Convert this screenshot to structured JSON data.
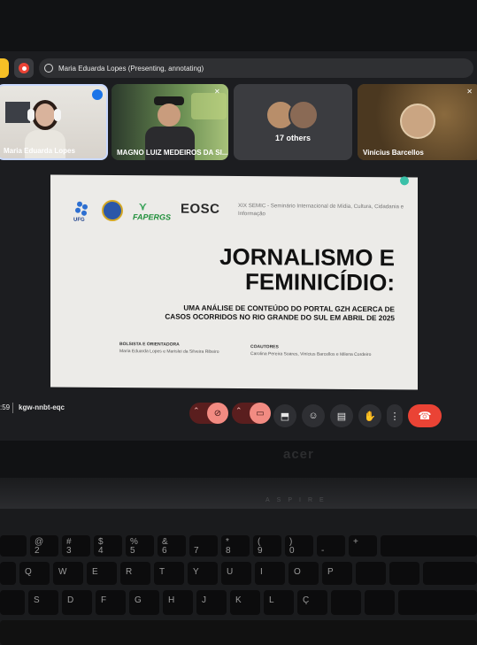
{
  "presenter_label": "Maria Eduarda Lopes (Presenting, annotating)",
  "participants": [
    {
      "name": "Maria Eduarda Lopes"
    },
    {
      "name": "MAGNO LUIZ MEDEIROS DA SI..."
    },
    {
      "name": "17 others"
    },
    {
      "name": "Vinícius Barcellos"
    }
  ],
  "slide": {
    "logos": [
      "UFG",
      "FAPERGS",
      "EOSC"
    ],
    "event": "XIX SEMIC - Seminário Internacional de Mídia, Cultura, Cidadania e Informação",
    "title_line1": "JORNALISMO E",
    "title_line2": "FEMINICÍDIO:",
    "subtitle_line1": "UMA ANÁLISE DE CONTEÚDO DO PORTAL GZH ACERCA DE",
    "subtitle_line2": "CASOS OCORRIDOS NO RIO GRANDE DO SUL EM ABRIL DE 2025",
    "left_heading": "BOLSISTA E ORIENTADORA",
    "left_names": "Maria Eduarda Lopes e Marislei da Silveira Ribeiro",
    "right_heading": "COAUTORES",
    "right_names": "Carolina Pereira Soares, Vinícius Barcellos e Milena Cordeiro"
  },
  "meeting": {
    "time": ":59",
    "code": "kgw-nnbt-eqc"
  },
  "laptop_brand": "acer",
  "laptop_model": "ASPIRE",
  "keys": {
    "row1": [
      "@",
      "2",
      "#",
      "3",
      "$",
      "4",
      "%",
      "5",
      "&",
      "6",
      "7",
      "*",
      "8",
      "(",
      "9",
      ")",
      "0",
      "-",
      "+"
    ],
    "row2": [
      "Q",
      "W",
      "E",
      "R",
      "T",
      "Y",
      "U",
      "I",
      "O",
      "P"
    ],
    "row3": [
      "S",
      "D",
      "F",
      "G",
      "H",
      "J",
      "K",
      "L",
      "Ç"
    ]
  },
  "colors": {
    "accent": "#4285f4",
    "leave": "#ea4335",
    "mic_off": "#f28b82"
  }
}
